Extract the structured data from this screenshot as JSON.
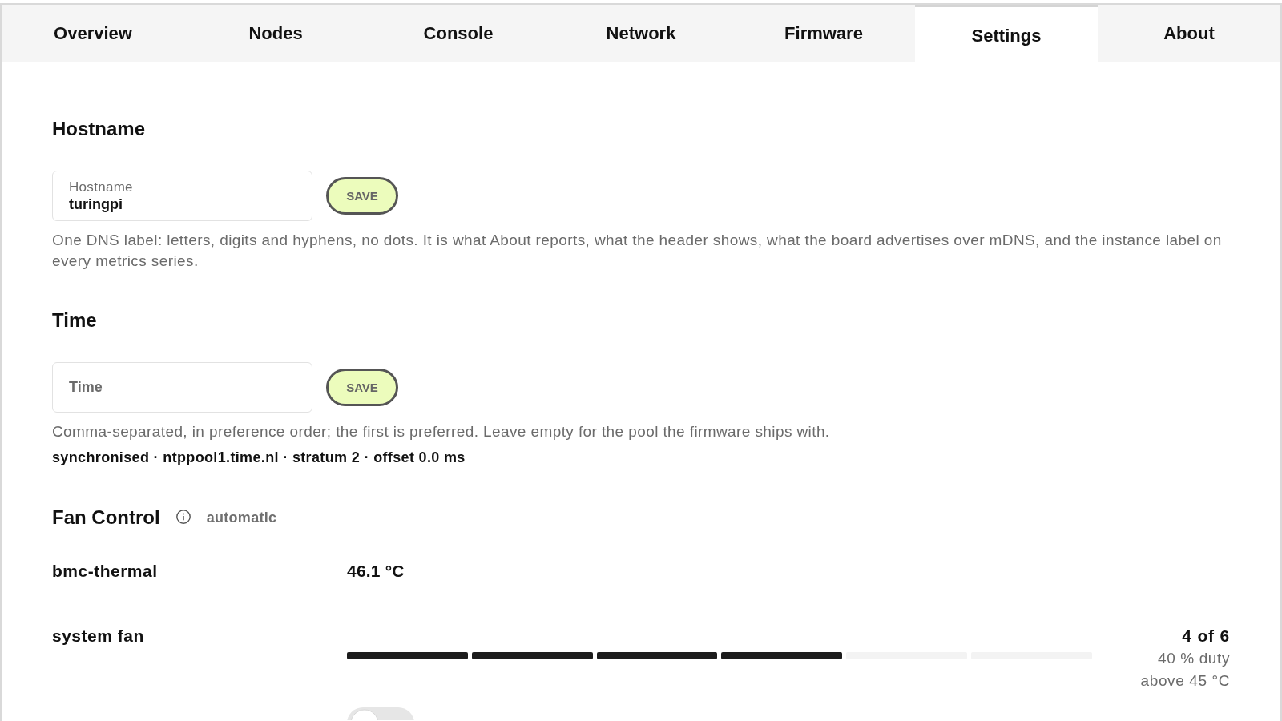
{
  "tabs": [
    {
      "label": "Overview",
      "selected": false
    },
    {
      "label": "Nodes",
      "selected": false
    },
    {
      "label": "Console",
      "selected": false
    },
    {
      "label": "Network",
      "selected": false
    },
    {
      "label": "Firmware",
      "selected": false
    },
    {
      "label": "Settings",
      "selected": true
    },
    {
      "label": "About",
      "selected": false
    }
  ],
  "hostname": {
    "title": "Hostname",
    "field": {
      "label": "Hostname",
      "value": "turingpi"
    },
    "button": "SAVE",
    "help": "One DNS label: letters, digits and hyphens, no dots. It is what About reports, what the header shows, what the board advertises over mDNS, and the instance label on every metrics series."
  },
  "time": {
    "title": "Time",
    "field": {
      "placeholder": "Time"
    },
    "button": "SAVE",
    "help": "Comma-separated, in preference order; the first is preferred. Leave empty for the pool the firmware ships with.",
    "status": "synchronised · ntppool1.time.nl · stratum 2 · offset 0.0 ms"
  },
  "fan_control": {
    "title": "Fan Control",
    "mode": "automatic",
    "sensors": [
      {
        "name": "bmc-thermal",
        "reading": "46.1 °C"
      }
    ],
    "fans": [
      {
        "name": "system fan",
        "segments": [
          {
            "filled": true
          },
          {
            "filled": true
          },
          {
            "filled": true
          },
          {
            "filled": true
          },
          {
            "filled": false
          },
          {
            "filled": false
          }
        ],
        "step": "4 of 6",
        "duty": "40 % duty",
        "threshold": "above 45 °C"
      }
    ],
    "toggle": {
      "on": false
    }
  }
}
